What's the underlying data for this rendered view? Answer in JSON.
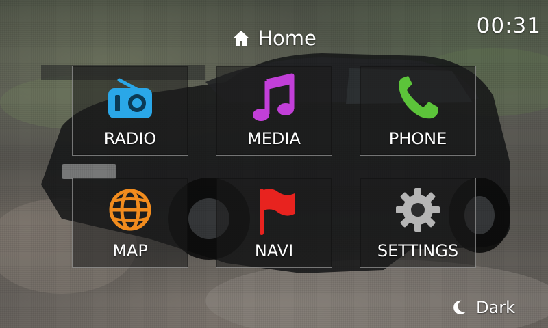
{
  "header": {
    "title": "Home",
    "icon": "home-icon"
  },
  "clock": {
    "time": "00:31"
  },
  "tiles": [
    {
      "label": "RADIO",
      "icon": "radio-icon",
      "color": "#2aa7e8"
    },
    {
      "label": "MEDIA",
      "icon": "music-note-icon",
      "color": "#c23fd8"
    },
    {
      "label": "PHONE",
      "icon": "phone-icon",
      "color": "#5cc43a"
    },
    {
      "label": "MAP",
      "icon": "globe-icon",
      "color": "#f28c1e"
    },
    {
      "label": "NAVI",
      "icon": "flag-icon",
      "color": "#e8231f"
    },
    {
      "label": "SETTINGS",
      "icon": "gear-icon",
      "color": "#b5b5b5"
    }
  ],
  "footer": {
    "theme_label": "Dark",
    "icon": "moon-icon"
  }
}
